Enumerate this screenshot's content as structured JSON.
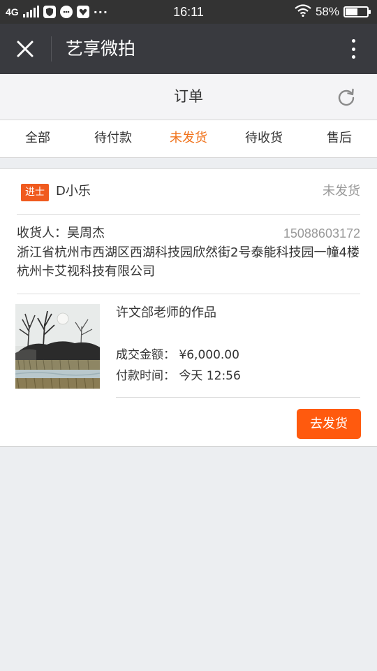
{
  "status_bar": {
    "network": "4G",
    "time": "16:11",
    "battery": "58%",
    "battery_level": 0.58,
    "more_glyph": "···",
    "icons": [
      "signal-icon",
      "shield-icon",
      "chat-icon",
      "heart-shield-icon",
      "more-dots-icon",
      "wifi-icon",
      "battery-icon"
    ]
  },
  "titlebar": {
    "title": "艺享微拍",
    "close_icon": "close-icon",
    "more_icon": "more-vertical-icon"
  },
  "page": {
    "title": "订单",
    "refresh_icon": "refresh-icon"
  },
  "tabs": [
    {
      "label": "全部",
      "active": false
    },
    {
      "label": "待付款",
      "active": false
    },
    {
      "label": "未发货",
      "active": true
    },
    {
      "label": "待收货",
      "active": false
    },
    {
      "label": "售后",
      "active": false
    }
  ],
  "order": {
    "level_badge": "进士",
    "buyer": "D小乐",
    "status": "未发货",
    "receiver": "收货人：吴周杰",
    "phone": "15088603172",
    "address": "浙江省杭州市西湖区西湖科技园欣然街2号泰能科技园一幢4楼杭州卡艾视科技有限公司",
    "product_title": "许文郃老师的作品",
    "amount": "成交金额： ¥6,000.00",
    "pay_time": "付款时间： 今天 12:56",
    "ship_button": "去发货"
  },
  "colors": {
    "accent": "#f0721b",
    "button": "#ff5a0e",
    "badge": "#f05a1e",
    "titlebar": "#393a3f",
    "statusbar": "#333333"
  }
}
